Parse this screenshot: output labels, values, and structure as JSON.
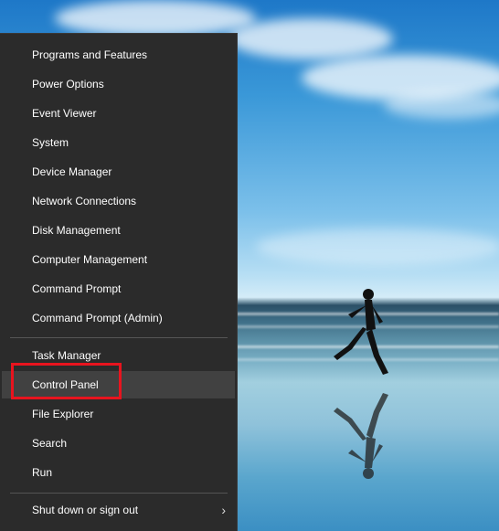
{
  "menu": {
    "items": [
      {
        "label": "Programs and Features"
      },
      {
        "label": "Power Options"
      },
      {
        "label": "Event Viewer"
      },
      {
        "label": "System"
      },
      {
        "label": "Device Manager"
      },
      {
        "label": "Network Connections"
      },
      {
        "label": "Disk Management"
      },
      {
        "label": "Computer Management"
      },
      {
        "label": "Command Prompt"
      },
      {
        "label": "Command Prompt (Admin)"
      }
    ],
    "items2": [
      {
        "label": "Task Manager"
      },
      {
        "label": "Control Panel",
        "hovered": true
      },
      {
        "label": "File Explorer"
      },
      {
        "label": "Search"
      },
      {
        "label": "Run"
      }
    ],
    "items3": [
      {
        "label": "Shut down or sign out",
        "icon": "chevron-right-icon"
      }
    ]
  },
  "colors": {
    "menu_bg": "#2b2b2b",
    "hover_bg": "#414141",
    "highlight_border": "#e8141e",
    "text": "#ffffff"
  }
}
